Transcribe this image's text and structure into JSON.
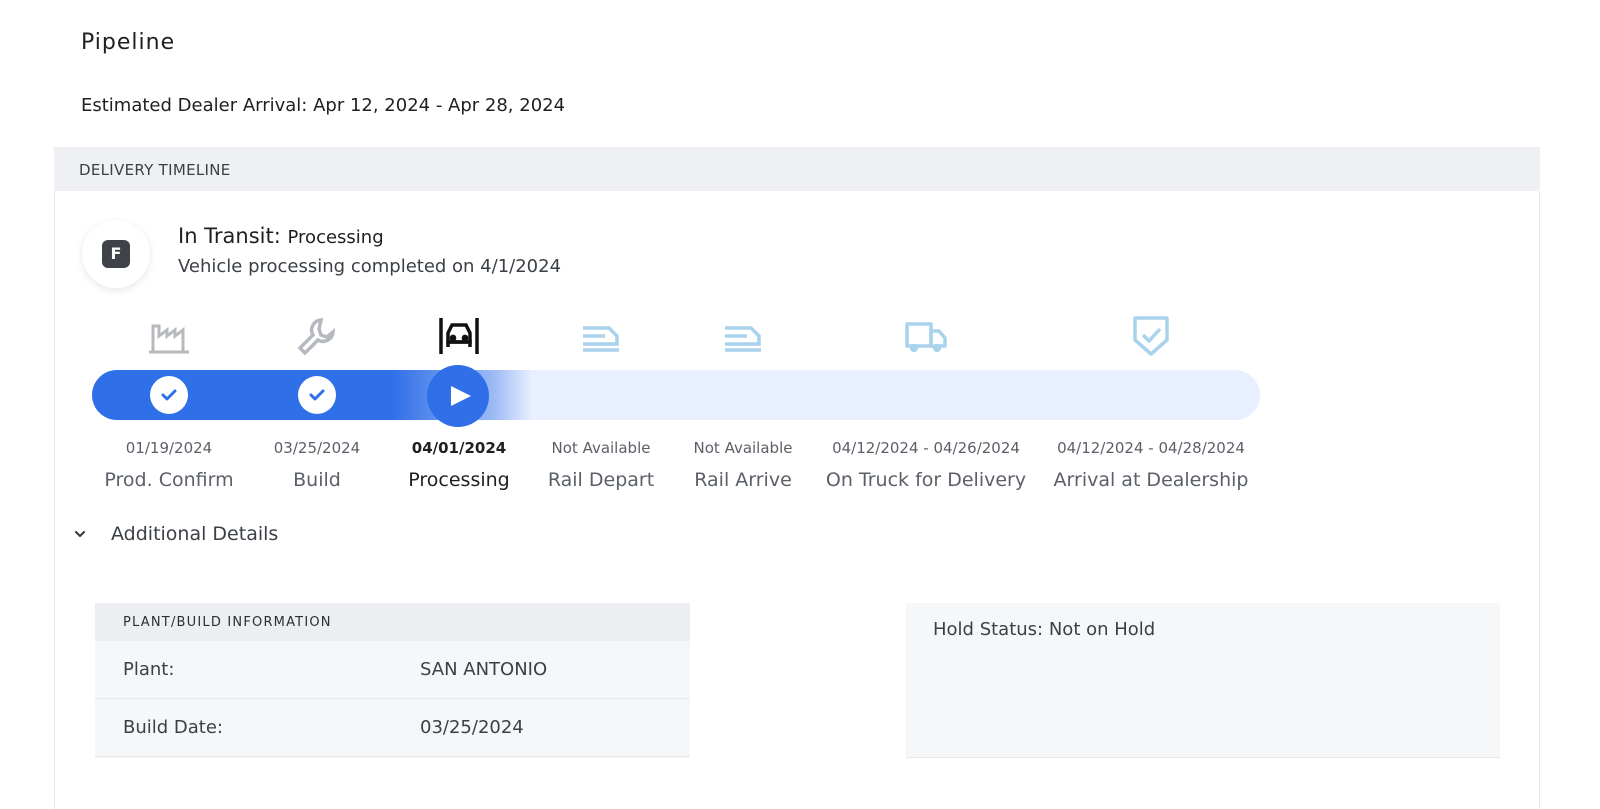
{
  "page": {
    "title": "Pipeline",
    "estimated_arrival": "Estimated Dealer Arrival: Apr 12, 2024 - Apr 28, 2024"
  },
  "timeline": {
    "header": "DELIVERY TIMELINE",
    "badge_letter": "F",
    "status_label": "In Transit:",
    "status_value": "Processing",
    "status_description": "Vehicle processing completed on 4/1/2024",
    "progress_fraction": 0.36,
    "stages": [
      {
        "icon": "factory-icon",
        "date": "01/19/2024",
        "label": "Prod. Confirm",
        "state": "complete"
      },
      {
        "icon": "wrench-icon",
        "date": "03/25/2024",
        "label": "Build",
        "state": "complete"
      },
      {
        "icon": "car-processing-icon",
        "date": "04/01/2024",
        "label": "Processing",
        "state": "current"
      },
      {
        "icon": "rail-depart-icon",
        "date": "Not Available",
        "label": "Rail Depart",
        "state": "pending"
      },
      {
        "icon": "rail-arrive-icon",
        "date": "Not Available",
        "label": "Rail Arrive",
        "state": "pending"
      },
      {
        "icon": "truck-icon",
        "date": "04/12/2024 - 04/26/2024",
        "label": "On Truck for Delivery",
        "state": "pending"
      },
      {
        "icon": "shield-check-icon",
        "date": "04/12/2024 - 04/28/2024",
        "label": "Arrival at Dealership",
        "state": "pending"
      }
    ],
    "colors": {
      "accent": "#2f6fe8",
      "track": "#e8efff",
      "pending_icon": "#a9d2ec",
      "done_icon": "#b6b9be"
    }
  },
  "additional_details": {
    "toggle_label": "Additional Details",
    "plant_card": {
      "heading": "PLANT/BUILD INFORMATION",
      "rows": [
        {
          "key": "Plant:",
          "value": "SAN ANTONIO"
        },
        {
          "key": "Build Date:",
          "value": "03/25/2024"
        }
      ]
    },
    "hold_status": "Hold Status: Not on Hold"
  }
}
